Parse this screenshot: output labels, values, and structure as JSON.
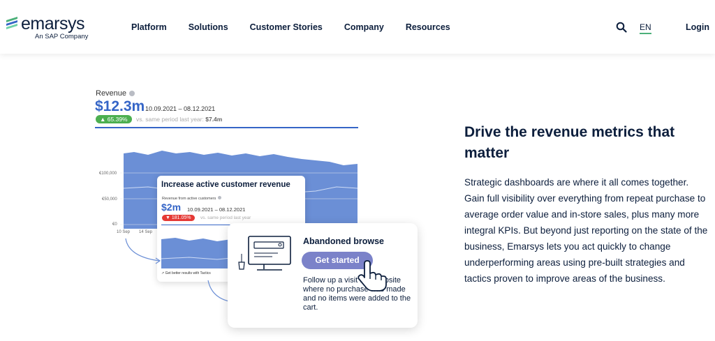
{
  "header": {
    "logo_text": "emarsys",
    "logo_sub": "An SAP Company",
    "nav": [
      "Platform",
      "Solutions",
      "Customer Stories",
      "Company",
      "Resources"
    ],
    "lang": "EN",
    "login": "Login",
    "search_icon": "search-icon"
  },
  "colors": {
    "brand_dark": "#0c1e3c",
    "accent_blue": "#3565c7",
    "chart_fill": "#6b8fd6",
    "button": "#7b82c9",
    "positive": "#4caf50",
    "negative": "#e53935",
    "lang_underline": "#4cb07a"
  },
  "revenue_widget": {
    "label": "Revenue",
    "value": "$12.3m",
    "dates": "10.09.2021 – 08.12.2021",
    "badge": "▲ 65.39%",
    "compare_text": "vs. same period last year:",
    "compare_value": "$7.4m",
    "y_ticks": [
      "€100,000",
      "€50,000",
      "€0"
    ],
    "x_ticks": [
      "10 Sep",
      "14 Sep"
    ]
  },
  "card_active": {
    "title": "Increase active customer revenue",
    "subtitle": "Revenue from active customers",
    "value": "$2m",
    "dates": "10.09.2021 – 08.12.2021",
    "badge": "▼ 181.05%",
    "compare_text": "vs. same period last year",
    "footer": "Get better results with Tactics"
  },
  "card_abandoned": {
    "title": "Abandoned browse",
    "button": "Get started",
    "description": "Follow up a visit to a website where no purchase was made and no items were added to the cart."
  },
  "content": {
    "headline": "Drive the revenue metrics that matter",
    "body": "Strategic dashboards are where it all comes together. Gain full visibility over everything from repeat purchase to average order value and in-store sales, plus many more integral KPIs. But beyond just reporting on the state of the business, Emarsys lets you act quickly to change underperforming areas using pre-built strategies and tactics proven to improve areas of the business."
  }
}
